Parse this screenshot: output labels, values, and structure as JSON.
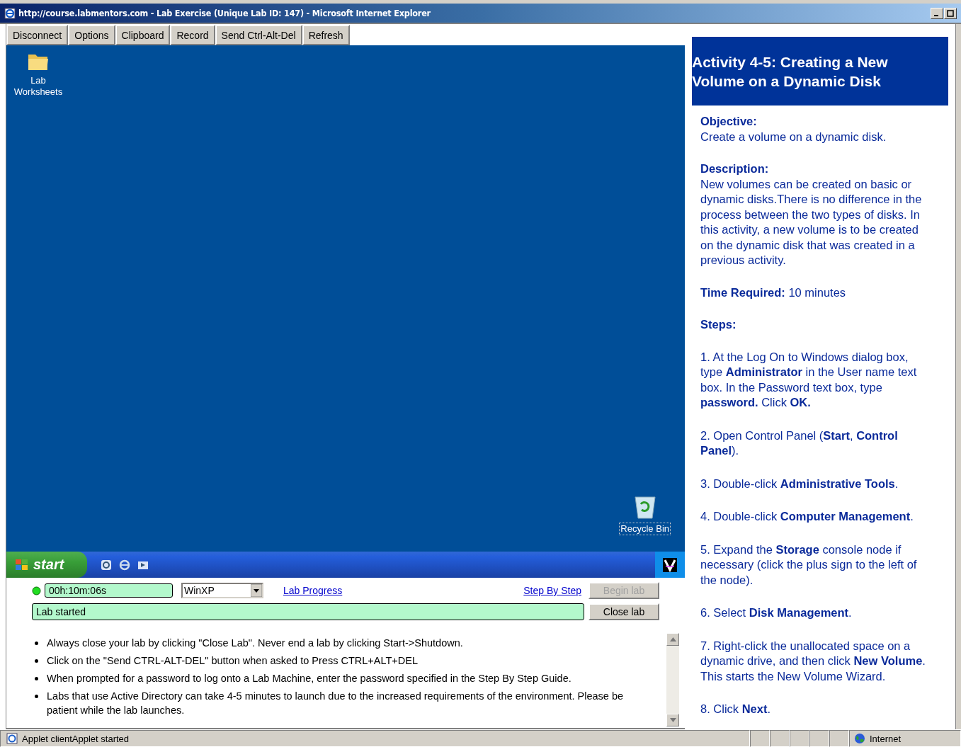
{
  "window": {
    "title": "http://course.labmentors.com - Lab Exercise (Unique Lab ID: 147) - Microsoft Internet Explorer"
  },
  "toolbar": {
    "buttons": [
      "Disconnect",
      "Options",
      "Clipboard",
      "Record",
      "Send Ctrl-Alt-Del",
      "Refresh"
    ]
  },
  "desktop": {
    "icons": [
      {
        "label": "Lab Worksheets",
        "kind": "folder"
      },
      {
        "label": "Recycle Bin",
        "kind": "recycle-bin"
      }
    ]
  },
  "taskbar": {
    "start_label": "start"
  },
  "lab_controls": {
    "timer": "00h:10m:06s",
    "machine": "WinXP",
    "lab_progress": "Lab Progress",
    "step_by_step": "Step By Step",
    "buttons": [
      {
        "label": "Begin lab",
        "disabled": true
      },
      {
        "label": "Close lab",
        "disabled": false
      }
    ],
    "status_text": "Lab started"
  },
  "notes": [
    "Always close your lab by clicking \"Close Lab\". Never end a lab by clicking Start->Shutdown.",
    "Click on the \"Send CTRL-ALT-DEL\" button when asked to Press CTRL+ALT+DEL",
    "When prompted for a password to log onto a Lab Machine, enter the password specified in the Step By Step Guide.",
    "Labs that use Active Directory can take 4-5 minutes to launch due to the increased requirements of the environment. Please be patient while the lab launches."
  ],
  "instructions": {
    "title": "Activity 4-5: Creating a New Volume on a Dynamic Disk",
    "objective": {
      "heading": "Objective:",
      "text": "Create a volume on a dynamic disk."
    },
    "description": {
      "heading": "Description:",
      "text": "New volumes can be created on basic or dynamic disks.There is no difference in the process between the two types of disks. In this activity, a new volume is to be created on the dynamic disk that was created in a previous activity."
    },
    "time_required": {
      "heading": "Time Required:",
      "text": "10 minutes"
    },
    "steps": {
      "heading": "Steps:",
      "items": [
        "1. At the Log On to Windows dialog box, type **Administrator** in the User name text box.  In the Password text box, type **password.** Click **OK.**",
        "2. Open Control Panel (**Start**, **Control Panel**).",
        "3. Double-click **Administrative Tools**.",
        "4. Double-click **Computer Management**.",
        "5. Expand the **Storage** console node if necessary (click the plus sign to the left of the node).",
        "6. Select **Disk Management**.",
        "7. Right-click the unallocated space on a dynamic drive, and then click **New Volume**. This starts the New Volume Wizard.",
        "8. Click **Next**."
      ]
    }
  },
  "status_bar": {
    "text": "Applet clientApplet started",
    "zone": "Internet"
  }
}
